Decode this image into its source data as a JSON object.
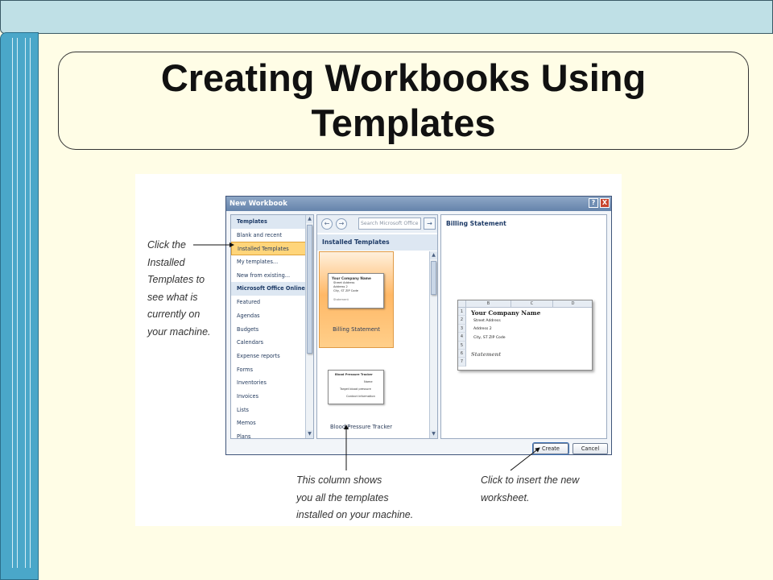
{
  "slide": {
    "title_line1": "Creating Workbooks Using",
    "title_line2": "Templates"
  },
  "callouts": {
    "left": [
      "Click the",
      "Installed",
      "Templates to",
      "see what is",
      "currently on",
      "your machine."
    ],
    "bottom": [
      "This column shows",
      "you all the templates",
      "installed on your machine."
    ],
    "right": [
      "Click to insert the new",
      "worksheet."
    ]
  },
  "dialog": {
    "title": "New Workbook",
    "help_glyph": "?",
    "close_glyph": "X",
    "left_pane": {
      "items": [
        {
          "label": "Templates",
          "kind": "header"
        },
        {
          "label": "Blank and recent",
          "kind": "item"
        },
        {
          "label": "Installed Templates",
          "kind": "selected"
        },
        {
          "label": "My templates...",
          "kind": "item"
        },
        {
          "label": "New from existing...",
          "kind": "item"
        },
        {
          "label": "Microsoft Office Online",
          "kind": "header"
        },
        {
          "label": "Featured",
          "kind": "item"
        },
        {
          "label": "Agendas",
          "kind": "item"
        },
        {
          "label": "Budgets",
          "kind": "item"
        },
        {
          "label": "Calendars",
          "kind": "item"
        },
        {
          "label": "Expense reports",
          "kind": "item"
        },
        {
          "label": "Forms",
          "kind": "item"
        },
        {
          "label": "Inventories",
          "kind": "item"
        },
        {
          "label": "Invoices",
          "kind": "item"
        },
        {
          "label": "Lists",
          "kind": "item"
        },
        {
          "label": "Memos",
          "kind": "item"
        },
        {
          "label": "Plans",
          "kind": "item"
        }
      ]
    },
    "middle_pane": {
      "search_placeholder": "Search Microsoft Office",
      "header": "Installed Templates",
      "templates": [
        {
          "label": "Billing Statement",
          "selected": true
        },
        {
          "label": "Blood Pressure Tracker",
          "selected": false
        }
      ],
      "thumb1": {
        "title": "Your Company Name",
        "lines": [
          "Street Address",
          "Address 2",
          "City, ST ZIP Code"
        ],
        "footer": "Statement"
      },
      "thumb2": {
        "title": "Blood Pressure Tracker",
        "lines": [
          "Name",
          "Target blood pressure",
          "Contact information"
        ]
      }
    },
    "preview": {
      "title": "Billing Statement",
      "columns": [
        "A",
        "B",
        "C",
        "D"
      ],
      "rows": [
        "1",
        "2",
        "3",
        "4",
        "5",
        "6",
        "7"
      ],
      "company": "Your Company Name",
      "street": "Street Address",
      "address2": "Address 2",
      "city": "City, ST  ZIP Code",
      "statement": "Statement"
    },
    "buttons": {
      "create": "Create",
      "cancel": "Cancel"
    }
  }
}
